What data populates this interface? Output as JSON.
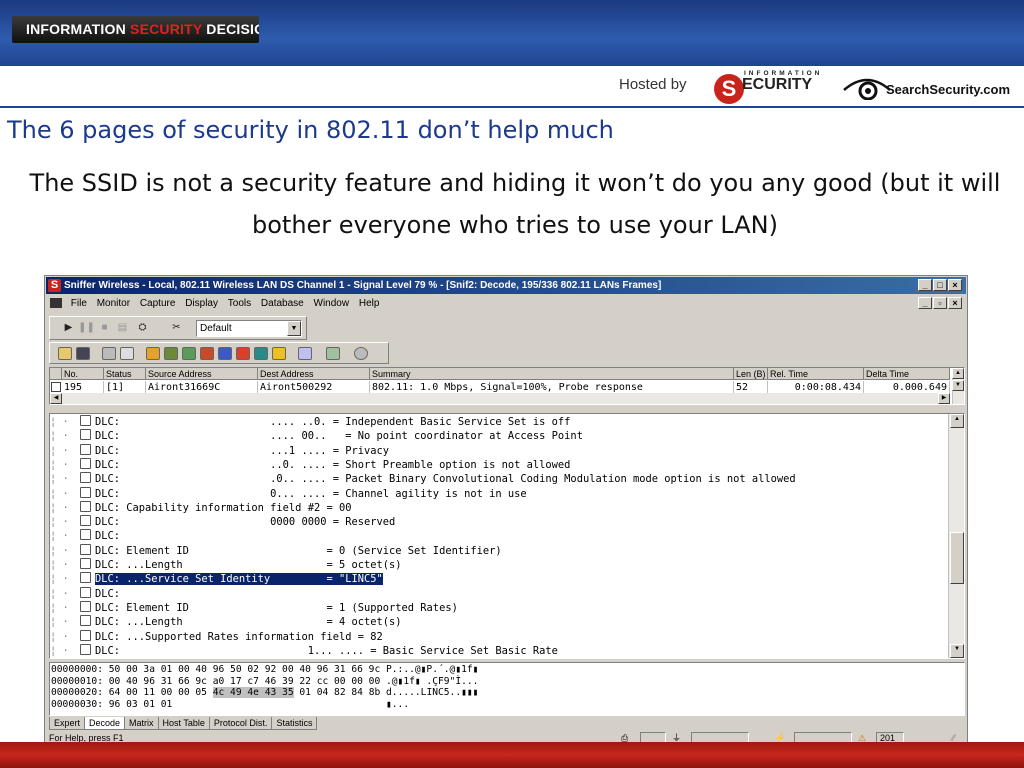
{
  "header": {
    "brand_white_1": "INFORMATION ",
    "brand_red": "SECURITY",
    "brand_white_2": " DECISIONS",
    "hosted_by": "Hosted by",
    "logo1_small": "INFORMATION",
    "logo1_big": "ECURITY",
    "logo1_s": "S",
    "logo2": "SearchSecurity.com"
  },
  "slide": {
    "title": "The 6 pages of security in 802.11 don’t help much",
    "subtitle": "The SSID is not a security feature and hiding it won’t do you any good (but it will bother everyone who tries to use your LAN)"
  },
  "window": {
    "title": "Sniffer Wireless - Local, 802.11 Wireless LAN DS Channel 1 - Signal Level  79 % - [Snif2: Decode, 195/336 802.11 LANs Frames]",
    "app_icon": "S",
    "menu": [
      "File",
      "Monitor",
      "Capture",
      "Display",
      "Tools",
      "Database",
      "Window",
      "Help"
    ],
    "filter_combo": "Default",
    "buttons": {
      "minimize": "_",
      "restore": "□",
      "close": "×",
      "child_restore": "▫"
    }
  },
  "summary": {
    "columns": [
      "No.",
      "Status",
      "Source Address",
      "Dest Address",
      "Summary",
      "Len (B)",
      "Rel. Time",
      "Delta Time"
    ],
    "row": [
      "195",
      "[1]",
      "Airont31669C",
      "Airont500292",
      "802.11:  1.0 Mbps, Signal=100%, Probe response",
      "52",
      "0:00:08.434",
      "0.000.649"
    ]
  },
  "decode_lines": [
    "DLC:                        .... ..0. = Independent Basic Service Set is off",
    "DLC:                        .... 00..   = No point coordinator at Access Point",
    "DLC:                        ...1 .... = Privacy",
    "DLC:                        ..0. .... = Short Preamble option is not allowed",
    "DLC:                        .0.. .... = Packet Binary Convolutional Coding Modulation mode option is not allowed",
    "DLC:                        0... .... = Channel agility is not in use",
    "DLC: Capability information field #2 = 00",
    "DLC:                        0000 0000 = Reserved",
    "DLC:",
    "DLC: Element ID                      = 0 (Service Set Identifier)",
    "DLC: ...Length                       = 5 octet(s)",
    "DLC: ...Service Set Identity         = \"LINC5\"",
    "DLC:",
    "DLC: Element ID                      = 1 (Supported Rates)",
    "DLC: ...Length                       = 4 octet(s)",
    "DLC: ...Supported Rates information field = 82",
    "DLC:                              1... .... = Basic Service Set Basic Rate"
  ],
  "hex_lines": [
    {
      "pre": "00000000: 50 00 3a 01 00 40 96 50 02 92 00 40 96 31 66 9c P.:..@▮P.´.@▮1f▮",
      "hl": "",
      "post": ""
    },
    {
      "pre": "00000010: 00 40 96 31 66 9c a0 17 c7 46 39 22 cc 00 00 00 .@▮1f▮ .ÇF9\"Ì...",
      "hl": "",
      "post": ""
    },
    {
      "pre": "00000020: 64 00 11 00 00 05 ",
      "hl": "4c 49 4e 43 35",
      "post": " 01 04 82 84 8b d.....LINC5..▮▮▮"
    },
    {
      "pre": "00000030: 96 03 01 01                                     ▮...",
      "hl": "",
      "post": ""
    }
  ],
  "tabs": [
    "Expert",
    "Decode",
    "Matrix",
    "Host Table",
    "Protocol Dist.",
    "Statistics"
  ],
  "status": {
    "help": "For Help, press F1",
    "count": "201"
  }
}
